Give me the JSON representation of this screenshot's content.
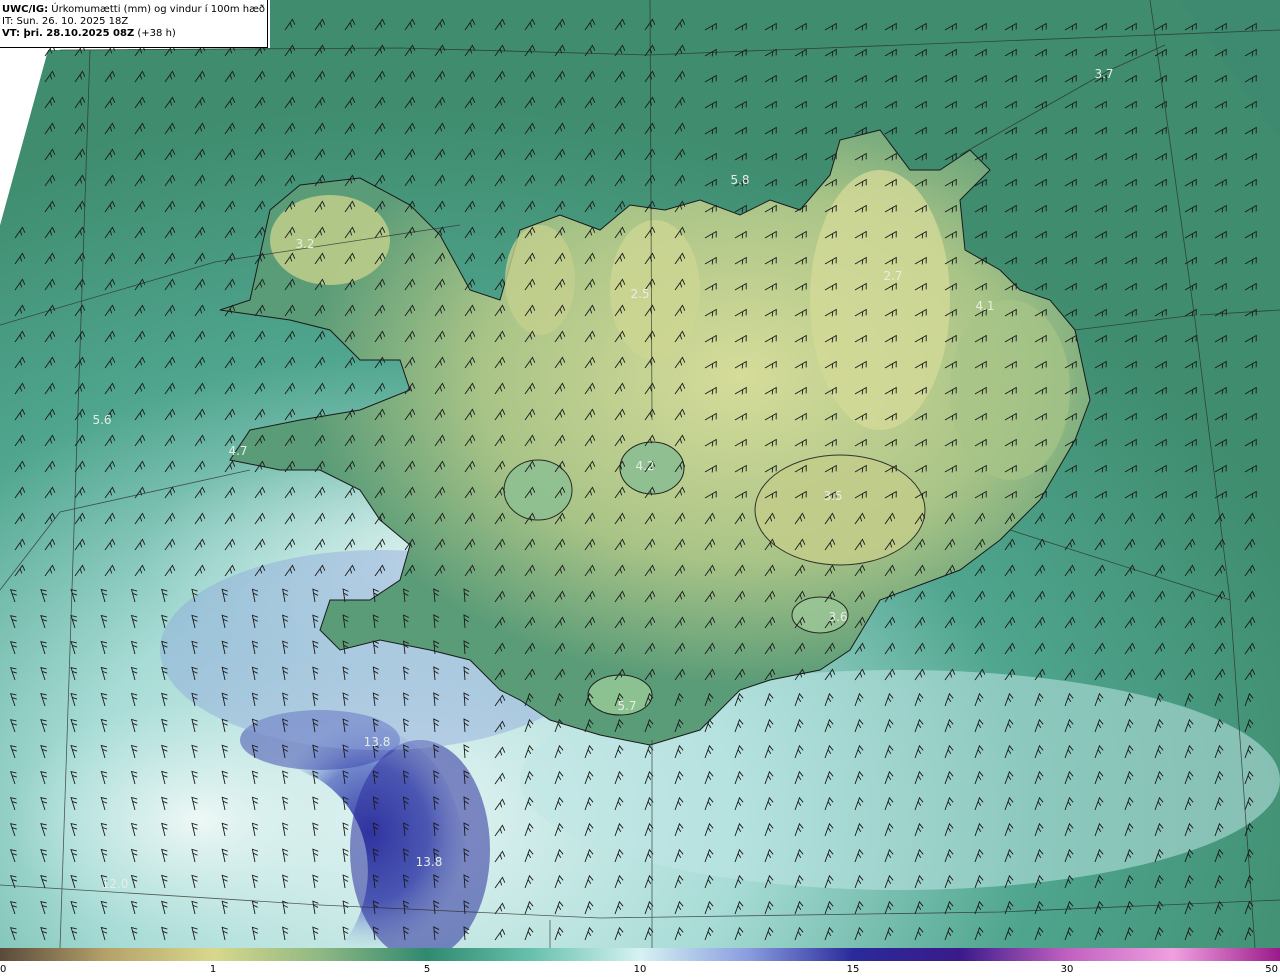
{
  "header": {
    "line1_bold": "UWC/IG:",
    "line1_text": " Úrkomumætti (mm) og vindur í 100m hæð",
    "line2": "IT: Sun. 26. 10. 2025 18Z",
    "line3_bold": "VT: þri. 28.10.2025 08Z",
    "line3_text": " (+38 h)"
  },
  "colorbar": {
    "ticks": [
      {
        "label": "0",
        "value": 0
      },
      {
        "label": "1",
        "value": 1
      },
      {
        "label": "5",
        "value": 5
      },
      {
        "label": "10",
        "value": 10
      },
      {
        "label": "15",
        "value": 15
      },
      {
        "label": "30",
        "value": 30
      },
      {
        "label": "50",
        "value": 50
      }
    ],
    "colors": [
      "#5a4a3a",
      "#b5a26a",
      "#d8d88c",
      "#8fb883",
      "#2f8a6e",
      "#68c2ae",
      "#d6f2f2",
      "#8a9ee0",
      "#2a2a9a",
      "#3a1a8a",
      "#c060c0",
      "#f0a0e0",
      "#9a1a8a"
    ]
  },
  "map_labels": [
    {
      "text": "3.7",
      "value": 3.7
    },
    {
      "text": "5.8",
      "value": 5.8
    },
    {
      "text": "3.2",
      "value": 3.2
    },
    {
      "text": "2.5",
      "value": 2.5
    },
    {
      "text": "2.7",
      "value": 2.7
    },
    {
      "text": "4.1",
      "value": 4.1
    },
    {
      "text": "5.6",
      "value": 5.6
    },
    {
      "text": "4.7",
      "value": 4.7
    },
    {
      "text": "4.2",
      "value": 4.2
    },
    {
      "text": "3.5",
      "value": 3.5
    },
    {
      "text": "3.6",
      "value": 3.6
    },
    {
      "text": "5.7",
      "value": 5.7
    },
    {
      "text": "13.8",
      "value": 13.8
    },
    {
      "text": "13.8",
      "value": 13.8
    },
    {
      "text": "12.0",
      "value": 12.0
    }
  ]
}
